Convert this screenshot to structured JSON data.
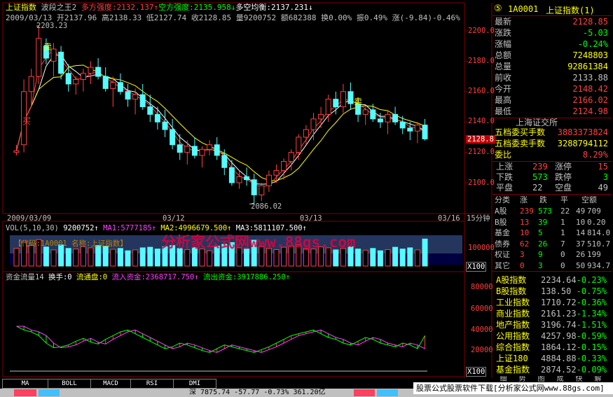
{
  "header": {
    "title": "上证指数",
    "indicator_name": "波段之王2",
    "bull_strength": "多方强度:2132.137",
    "bear_strength": "空方强度:2135.958",
    "bull_avg": "多空均衡:2137.231"
  },
  "ohlc_line": {
    "date": "2009/03/13",
    "open": "开2137.96",
    "high": "高2138.33",
    "low": "低2127.74",
    "close": "收2128.85",
    "volume": "量9200752",
    "amount": "额682388",
    "turnover": "换0.00%",
    "amplitude": "振0.49%",
    "change": "涨(-9.84)-0.46%"
  },
  "annotations": {
    "high_label": "2203.23",
    "low_label": "2086.02",
    "sell_1": "卖",
    "sell_2": "卖",
    "buy_1": "买"
  },
  "price_axis": [
    "2200.0",
    "2180.0",
    "2160.0",
    "2140.0",
    "2120.0",
    "2100.0"
  ],
  "price_tag": "2128.8",
  "date_axis": [
    "2009/03/09",
    "03/12",
    "03/13",
    "03/16"
  ],
  "period": "15分钟",
  "volume_panel": {
    "label": "VOL(5,10,30)",
    "vol": "9200752",
    "ma1": "MA1:5777185",
    "ma2": "MA2:4996679.500",
    "ma3": "MA3:5811107.500",
    "overlay": "【代码:1A0001 名称:上证指数】",
    "watermark": "分析家公式网www.88gs.com",
    "axis": "100000",
    "scale": "X100"
  },
  "flow_panel": {
    "label": "资金流量14",
    "turnover": "换手:0",
    "circulating": "流通盘:0",
    "inflow": "流入资金:2368717.750",
    "outflow": "流出资金:3917886.250",
    "axis": [
      "80000",
      "60000",
      "40000",
      "20000"
    ],
    "scale": "X100"
  },
  "tabs": [
    "MA",
    "BOLL",
    "MACD",
    "RSI",
    "DMI"
  ],
  "status_bar": {
    "ticker": "深 7875.74 -57.77 -0.73% 361.20亿",
    "ad": "股票公式股票软件下载[分析家公式网www.88gs.com]"
  },
  "quote": {
    "badge": "⑤",
    "code": "1A0001",
    "name": "上证指数(1)",
    "rows": [
      {
        "k": "最新",
        "v": "2128.85",
        "c": "#ff4040"
      },
      {
        "k": "涨跌",
        "v": "-5.03",
        "c": "#00ff00"
      },
      {
        "k": "涨幅",
        "v": "-0.24%",
        "c": "#00ff00"
      },
      {
        "k": "总额",
        "v": "7248803",
        "c": "#ffff00"
      },
      {
        "k": "总量",
        "v": "92861384",
        "c": "#ffff00"
      },
      {
        "k": "前收",
        "v": "2133.88",
        "c": "#c0c0c0"
      },
      {
        "k": "今开",
        "v": "2148.42",
        "c": "#ff4040"
      },
      {
        "k": "最高",
        "v": "2166.02",
        "c": "#ff4040"
      },
      {
        "k": "最低",
        "v": "2124.98",
        "c": "#ff4040"
      }
    ],
    "exchange": "上海证交所",
    "bid_label": "五档委买手数",
    "bid_value": "3883373824",
    "ask_label": "五档委卖手数",
    "ask_value": "3288794112",
    "ratio_label": "委比",
    "ratio_value": "8.29%",
    "adv": [
      {
        "k": "上涨",
        "v": "239",
        "k2": "涨停",
        "v2": "15"
      },
      {
        "k": "下跌",
        "v": "573",
        "k2": "跌停",
        "v2": "3"
      },
      {
        "k": "平盘",
        "v": "22",
        "k2": "空盘",
        "v2": "49"
      }
    ],
    "class_head": [
      "分类",
      "涨",
      "跌",
      "平",
      "空额"
    ],
    "classes": [
      {
        "n": "A股",
        "a": "239",
        "b": "573",
        "c": "22",
        "d": "49",
        "e": "709"
      },
      {
        "n": "B股",
        "a": "13",
        "b": "39",
        "c": "1",
        "d": "10",
        "e": "0.20"
      },
      {
        "n": "基金",
        "a": "10",
        "b": "5",
        "c": "1",
        "d": "14",
        "e": "814.0"
      },
      {
        "n": "债券",
        "a": "62",
        "b": "26",
        "c": "7",
        "d": "37",
        "e": "510.7"
      },
      {
        "n": "权证",
        "a": "3",
        "b": "9",
        "c": "0",
        "d": "26",
        "e": "199"
      },
      {
        "n": "其它",
        "a": "0",
        "b": "3",
        "c": "0",
        "d": "50",
        "e": "934.7"
      }
    ],
    "indices": [
      {
        "n": "A股指数",
        "v": "2234.64",
        "p": "-0.23%"
      },
      {
        "n": "B股指数",
        "v": "138.50",
        "p": "-0.75%"
      },
      {
        "n": "工业指数",
        "v": "1710.72",
        "p": "-0.36%"
      },
      {
        "n": "商业指数",
        "v": "2161.23",
        "p": "-1.34%"
      },
      {
        "n": "地产指数",
        "v": "3196.74",
        "p": "-1.51%"
      },
      {
        "n": "公用指数",
        "v": "4257.98",
        "p": "-0.59%"
      },
      {
        "n": "综合指数",
        "v": "1864.12",
        "p": "-0.15%"
      },
      {
        "n": "上证180",
        "v": "4884.88",
        "p": "-0.33%"
      },
      {
        "n": "基金指数",
        "v": "2874.52",
        "p": "-0.09%"
      }
    ],
    "bottom_tabs": [
      "细",
      "势",
      "图",
      "成",
      "快",
      "解"
    ]
  },
  "chart_data": {
    "type": "candlestick",
    "ylim": [
      2080,
      2210
    ],
    "candles": [
      [
        2120,
        2125,
        2118,
        2121
      ],
      [
        2125,
        2168,
        2120,
        2160
      ],
      [
        2160,
        2175,
        2150,
        2170
      ],
      [
        2170,
        2203.23,
        2165,
        2195
      ],
      [
        2190,
        2195,
        2178,
        2182
      ],
      [
        2180,
        2192,
        2170,
        2188
      ],
      [
        2186,
        2190,
        2168,
        2172
      ],
      [
        2172,
        2178,
        2160,
        2165
      ],
      [
        2165,
        2170,
        2158,
        2168
      ],
      [
        2168,
        2175,
        2160,
        2172
      ],
      [
        2172,
        2180,
        2165,
        2176
      ],
      [
        2176,
        2182,
        2168,
        2170
      ],
      [
        2170,
        2176,
        2160,
        2162
      ],
      [
        2162,
        2170,
        2150,
        2166
      ],
      [
        2166,
        2172,
        2158,
        2160
      ],
      [
        2160,
        2165,
        2150,
        2155
      ],
      [
        2155,
        2162,
        2145,
        2158
      ],
      [
        2158,
        2165,
        2148,
        2150
      ],
      [
        2150,
        2158,
        2140,
        2145
      ],
      [
        2145,
        2150,
        2135,
        2140
      ],
      [
        2140,
        2148,
        2130,
        2135
      ],
      [
        2135,
        2142,
        2122,
        2125
      ],
      [
        2125,
        2132,
        2115,
        2120
      ],
      [
        2120,
        2128,
        2112,
        2124
      ],
      [
        2124,
        2130,
        2116,
        2118
      ],
      [
        2118,
        2124,
        2110,
        2122
      ],
      [
        2122,
        2128,
        2118,
        2125
      ],
      [
        2125,
        2130,
        2115,
        2118
      ],
      [
        2118,
        2122,
        2105,
        2110
      ],
      [
        2110,
        2115,
        2098,
        2100
      ],
      [
        2100,
        2108,
        2096,
        2104
      ],
      [
        2104,
        2110,
        2098,
        2102
      ],
      [
        2102,
        2106,
        2086.02,
        2092
      ],
      [
        2092,
        2100,
        2088,
        2098
      ],
      [
        2098,
        2108,
        2094,
        2105
      ],
      [
        2105,
        2112,
        2100,
        2108
      ],
      [
        2108,
        2116,
        2102,
        2114
      ],
      [
        2114,
        2122,
        2108,
        2120
      ],
      [
        2120,
        2132,
        2115,
        2130
      ],
      [
        2130,
        2138,
        2125,
        2135
      ],
      [
        2135,
        2146,
        2128,
        2142
      ],
      [
        2142,
        2150,
        2136,
        2145
      ],
      [
        2145,
        2158,
        2140,
        2155
      ],
      [
        2155,
        2160,
        2145,
        2150
      ],
      [
        2150,
        2165,
        2146,
        2160
      ],
      [
        2160,
        2166,
        2148,
        2152
      ],
      [
        2152,
        2156,
        2140,
        2145
      ],
      [
        2145,
        2150,
        2138,
        2148
      ],
      [
        2148,
        2152,
        2140,
        2142
      ],
      [
        2142,
        2146,
        2136,
        2140
      ],
      [
        2140,
        2148,
        2132,
        2145
      ],
      [
        2145,
        2150,
        2138,
        2140
      ],
      [
        2140,
        2144,
        2132,
        2136
      ],
      [
        2136,
        2140,
        2128,
        2134
      ],
      [
        2134,
        2140,
        2126,
        2138
      ],
      [
        2138,
        2142,
        2127.74,
        2128.85
      ]
    ],
    "volumes": [
      60,
      85,
      70,
      90,
      65,
      55,
      72,
      60,
      58,
      66,
      62,
      70,
      68,
      57,
      60,
      52,
      55,
      62,
      64,
      58,
      66,
      70,
      60,
      56,
      63,
      58,
      52,
      68,
      74,
      80,
      62,
      58,
      88,
      66,
      60,
      56,
      64,
      68,
      72,
      60,
      58,
      65,
      62,
      55,
      60,
      66,
      58,
      54,
      60,
      52,
      56,
      64,
      58,
      62,
      55,
      92
    ],
    "flow": [
      48,
      44,
      42,
      38,
      30,
      25,
      26,
      28,
      32,
      35,
      31,
      29,
      34,
      38,
      42,
      44,
      40,
      36,
      32,
      28,
      24,
      26,
      30,
      28,
      25,
      22,
      20,
      24,
      28,
      26,
      24,
      22,
      20,
      23,
      26,
      30,
      34,
      38,
      40,
      42,
      44,
      40,
      36,
      34,
      30,
      28,
      32,
      36,
      34,
      30,
      28,
      26,
      30,
      28,
      24,
      38
    ],
    "flow_ylim": [
      0,
      90000
    ]
  }
}
